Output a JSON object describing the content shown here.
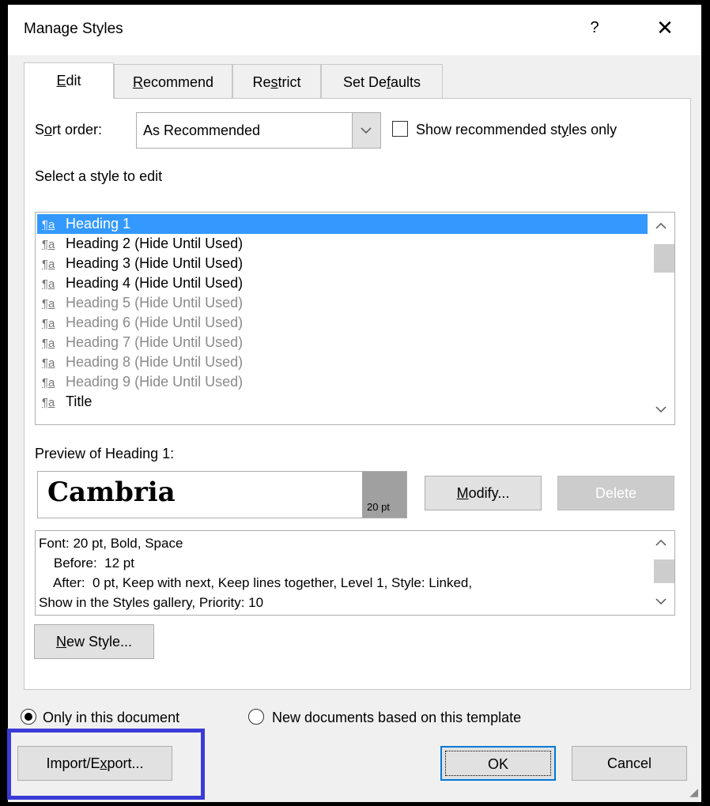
{
  "dialog": {
    "title": "Manage Styles",
    "help": "?",
    "close": "✕"
  },
  "tabs": [
    {
      "pre": "",
      "key": "E",
      "post": "dit",
      "active": true
    },
    {
      "pre": "",
      "key": "R",
      "post": "ecommend",
      "active": false
    },
    {
      "pre": "Re",
      "key": "s",
      "post": "trict",
      "active": false
    },
    {
      "pre": "Set De",
      "key": "f",
      "post": "aults",
      "active": false
    }
  ],
  "edit": {
    "sort_label_pre": "S",
    "sort_label_key": "o",
    "sort_label_post": "rt order:",
    "sort_value": "As Recommended",
    "show_recommended_pre": "Show recommended st",
    "show_recommended_key": "y",
    "show_recommended_post": "les only",
    "show_recommended_checked": false,
    "select_label": "Select a style to edit",
    "styles": [
      {
        "name": "Heading 1",
        "note": "",
        "state": "selected"
      },
      {
        "name": "Heading 2",
        "note": " (Hide Until Used)",
        "state": "normal"
      },
      {
        "name": "Heading 3",
        "note": " (Hide Until Used)",
        "state": "normal"
      },
      {
        "name": "Heading 4",
        "note": " (Hide Until Used)",
        "state": "normal"
      },
      {
        "name": "Heading 5",
        "note": " (Hide Until Used)",
        "state": "grey"
      },
      {
        "name": "Heading 6",
        "note": " (Hide Until Used)",
        "state": "grey"
      },
      {
        "name": "Heading 7",
        "note": " (Hide Until Used)",
        "state": "grey"
      },
      {
        "name": "Heading 8",
        "note": " (Hide Until Used)",
        "state": "grey"
      },
      {
        "name": "Heading 9",
        "note": " (Hide Until Used)",
        "state": "grey"
      },
      {
        "name": "Title",
        "note": "",
        "state": "normal"
      }
    ],
    "style_icon": "¶a",
    "preview_label": "Preview of Heading 1:",
    "preview_font": "Cambria",
    "preview_size": "20 pt",
    "modify_key": "M",
    "modify_post": "odify...",
    "delete_label": "Delete",
    "description_lines": [
      "Font: 20 pt, Bold, Space",
      "    Before:  12 pt",
      "    After:  0 pt, Keep with next, Keep lines together, Level 1, Style: Linked,",
      "Show in the Styles gallery, Priority: 10"
    ],
    "new_style_key": "N",
    "new_style_post": "ew Style..."
  },
  "scope": {
    "only_doc": "Only in this document",
    "new_docs": "New documents based on this template",
    "selected": "only_doc"
  },
  "footer": {
    "import_pre": "Import/E",
    "import_key": "x",
    "import_post": "port...",
    "ok": "OK",
    "cancel": "Cancel"
  },
  "colors": {
    "selection": "#3399ff",
    "highlight_box": "#3b3bd6",
    "default_button_border": "#0078d7"
  }
}
